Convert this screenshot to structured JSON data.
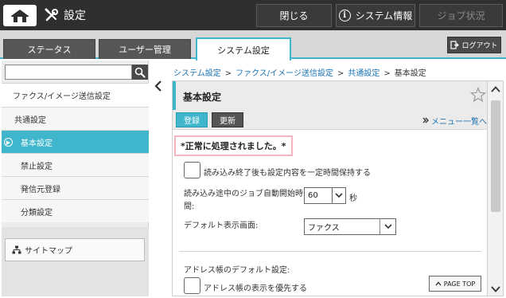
{
  "header": {
    "title": "設定",
    "close_label": "閉じる",
    "system_info_label": "システム情報",
    "job_status_label": "ジョブ状況"
  },
  "tabs": [
    {
      "label": "ステータス"
    },
    {
      "label": "ユーザー管理"
    },
    {
      "label": "システム設定",
      "active": true
    }
  ],
  "logout_label": "ログアウト",
  "sidebar": {
    "search_value": "",
    "items": [
      {
        "label": "ファクス/イメージ送信設定"
      },
      {
        "label": "共通設定"
      },
      {
        "label": "基本設定",
        "active": true
      },
      {
        "label": "禁止設定"
      },
      {
        "label": "発信元登録"
      },
      {
        "label": "分類設定"
      }
    ],
    "sitemap_label": "サイトマップ"
  },
  "breadcrumb": [
    "システム設定",
    "ファクス/イメージ送信設定",
    "共通設定",
    "基本設定"
  ],
  "panel": {
    "title": "基本設定",
    "register_label": "登録",
    "update_label": "更新",
    "menu_list_label": "メニュー一覧へ",
    "success_message": "*正常に処理されました。*",
    "keep_settings_label": "読み込み終了後も設定内容を一定時間保持する",
    "auto_start_label": "読み込み途中のジョブ自動開始時間:",
    "auto_start_value": "60",
    "auto_start_unit": "秒",
    "default_screen_label": "デフォルト表示画面:",
    "default_screen_value": "ファクス",
    "address_book_default_label": "アドレス帳のデフォルト設定:",
    "address_book_priority_label": "アドレス帳の表示を優先する",
    "page_top_label": "PAGE TOP"
  },
  "colors": {
    "accent": "#3fb6cc",
    "topbar": "#2f2f2f",
    "success_border": "#f6b4c0"
  }
}
